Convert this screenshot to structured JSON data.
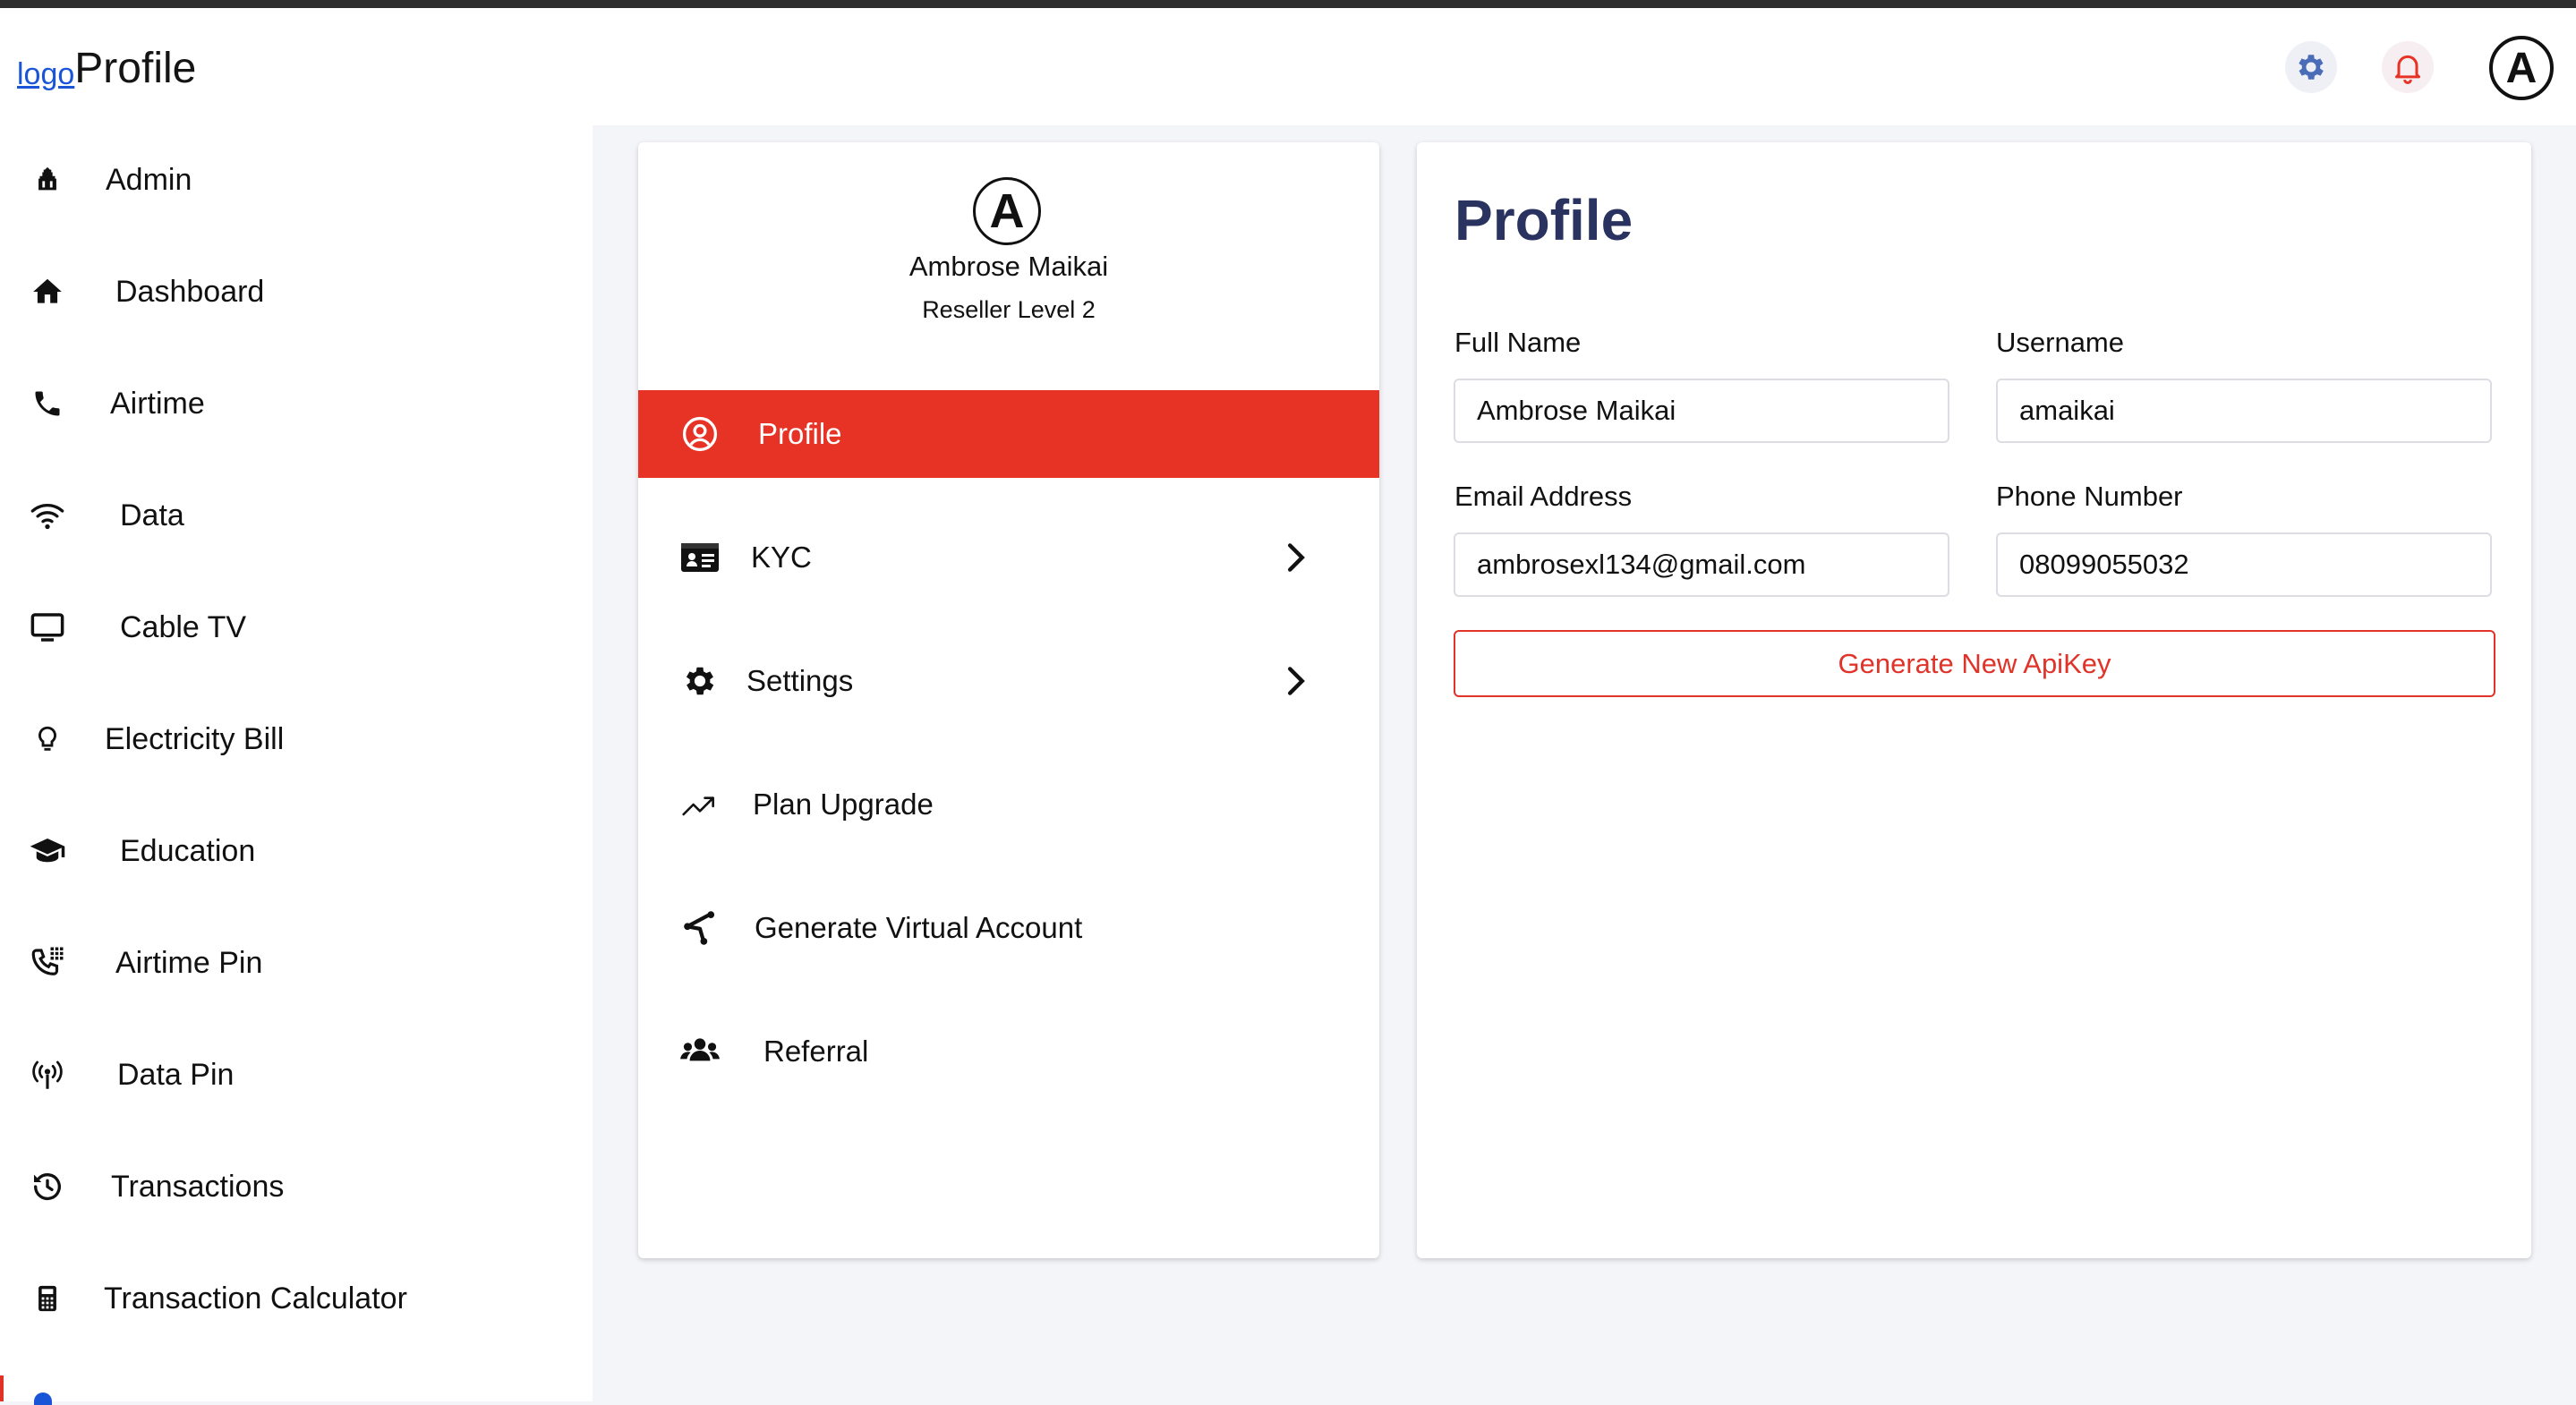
{
  "header": {
    "logo_alt": "logo",
    "title": "Profile",
    "settings_icon": "gear-icon",
    "notifications_icon": "bell-icon",
    "avatar_letter": "A"
  },
  "sidebar": {
    "items": [
      {
        "label": "Admin",
        "icon": "admin-icon"
      },
      {
        "label": "Dashboard",
        "icon": "home-icon"
      },
      {
        "label": "Airtime",
        "icon": "phone-icon"
      },
      {
        "label": "Data",
        "icon": "wifi-icon"
      },
      {
        "label": "Cable TV",
        "icon": "tv-icon"
      },
      {
        "label": "Electricity Bill",
        "icon": "bulb-icon"
      },
      {
        "label": "Education",
        "icon": "graduation-cap-icon"
      },
      {
        "label": "Airtime Pin",
        "icon": "dialpad-icon"
      },
      {
        "label": "Data Pin",
        "icon": "antenna-icon"
      },
      {
        "label": "Transactions",
        "icon": "history-icon"
      },
      {
        "label": "Transaction Calculator",
        "icon": "calculator-icon"
      }
    ]
  },
  "profile_card": {
    "avatar_letter": "A",
    "name": "Ambrose Maikai",
    "level": "Reseller Level 2",
    "menu": [
      {
        "label": "Profile",
        "icon": "user-circle-icon",
        "active": true
      },
      {
        "label": "KYC",
        "icon": "id-card-icon",
        "has_chevron": true
      },
      {
        "label": "Settings",
        "icon": "gear-icon",
        "has_chevron": true
      },
      {
        "label": "Plan Upgrade",
        "icon": "trending-up-icon"
      },
      {
        "label": "Generate Virtual Account",
        "icon": "share-icon"
      },
      {
        "label": "Referral",
        "icon": "users-icon"
      }
    ]
  },
  "profile_form": {
    "title": "Profile",
    "full_name_label": "Full Name",
    "full_name_value": "Ambrose Maikai",
    "username_label": "Username",
    "username_value": "amaikai",
    "email_label": "Email Address",
    "email_value": "ambrosexl134@gmail.com",
    "phone_label": "Phone Number",
    "phone_value": "08099055032",
    "apikey_button": "Generate New ApiKey"
  },
  "colors": {
    "accent_red": "#e63325",
    "title_navy": "#2a3360",
    "background": "#f4f5f9"
  }
}
